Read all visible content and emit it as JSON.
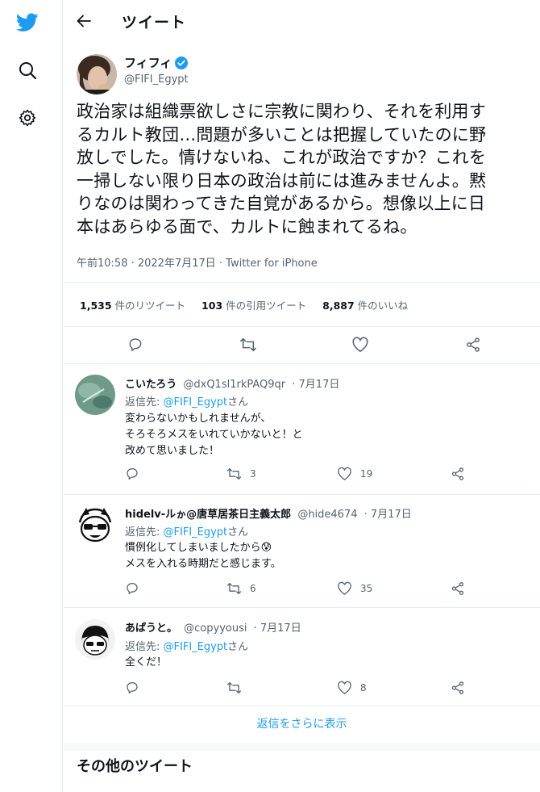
{
  "header": {
    "title": "ツイート"
  },
  "tweet": {
    "author_name": "フィフィ",
    "author_handle": "@FIFI_Egypt",
    "text_lines": [
      "政治家は組織票欲しさに宗教に関わり、それを利用す",
      "るカルト教団…問題が多いことは把握していたのに野",
      "放しでした。情けないね、これが政治ですか？これを",
      "一掃しない限り日本の政治は前には進みませんよ。黙",
      "りなのは関わってきた自覚があるから。想像以上に日",
      "本はあらゆる面で、カルトに蝕まれてるね。"
    ],
    "meta": "午前10:58 · 2022年7月17日 · Twitter for iPhone",
    "stats": {
      "retweets_count": "1,535",
      "retweets_label": "件のリツイート",
      "quotes_count": "103",
      "quotes_label": "件の引用ツイート",
      "likes_count": "8,887",
      "likes_label": "件のいいね"
    }
  },
  "replies": [
    {
      "name": "こいたろう",
      "handle": "@dxQ1sl1rkPAQ9qr",
      "date": "· 7月17日",
      "reply_prefix": "返信先: ",
      "reply_to": "@FIFI_Egypt",
      "reply_suffix": "さん",
      "lines": [
        "変わらないかもしれませんが、",
        "そろそろメスをいれていかないと！と",
        "改めて思いました！"
      ],
      "retweets": "3",
      "likes": "19"
    },
    {
      "name": "hidelv-ルゕ@唐草居茶日主義太郎",
      "handle": "@hide4674",
      "date": "· 7月17日",
      "reply_prefix": "返信先: ",
      "reply_to": "@FIFI_Egypt",
      "reply_suffix": "さん",
      "lines": [
        "慣例化してしまいましたから😰",
        "メスを入れる時期だと感じます。"
      ],
      "retweets": "6",
      "likes": "35"
    },
    {
      "name": "あぱうと。",
      "handle": "@copyyousi",
      "date": "· 7月17日",
      "reply_prefix": "返信先: ",
      "reply_to": "@FIFI_Egypt",
      "reply_suffix": "さん",
      "lines": [
        "全くだ！"
      ],
      "retweets": "",
      "likes": "8"
    }
  ],
  "more_replies_label": "返信をさらに表示",
  "other_tweets_title": "その他のツイート",
  "colors": {
    "accent": "#1d9bf0",
    "text": "#0f1419",
    "secondary": "#536471",
    "divider": "#e6ecf0"
  },
  "icons": {
    "rail": [
      "twitter-logo-icon",
      "search-icon",
      "settings-gear-icon"
    ],
    "actions": [
      "reply-icon",
      "retweet-icon",
      "like-icon",
      "share-icon"
    ]
  }
}
